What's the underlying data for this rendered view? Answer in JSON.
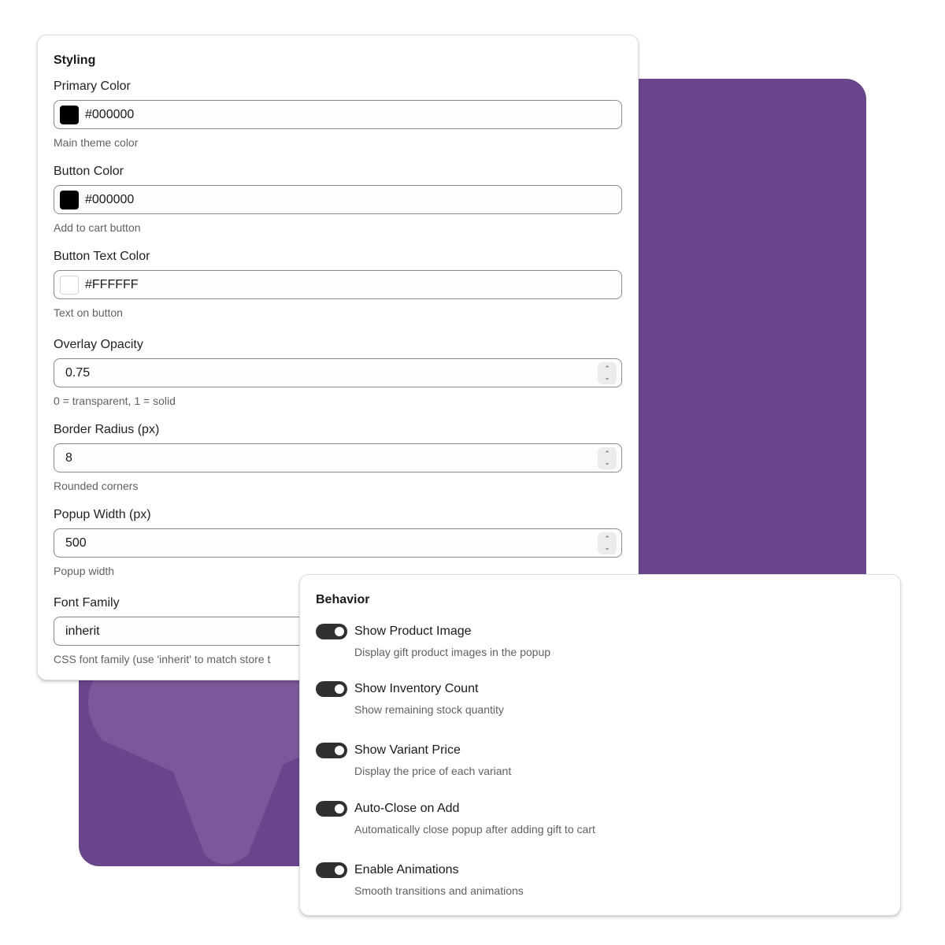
{
  "colors": {
    "background_card": "#6b458c",
    "toggle_on": "#303030"
  },
  "styling": {
    "title": "Styling",
    "primary_color": {
      "label": "Primary Color",
      "value": "#000000",
      "help": "Main theme color",
      "swatch": "#000000"
    },
    "button_color": {
      "label": "Button Color",
      "value": "#000000",
      "help": "Add to cart button",
      "swatch": "#000000"
    },
    "button_text_color": {
      "label": "Button Text Color",
      "value": "#FFFFFF",
      "help": "Text on button",
      "swatch": "#FFFFFF"
    },
    "overlay_opacity": {
      "label": "Overlay Opacity",
      "value": "0.75",
      "help": "0 = transparent, 1 = solid"
    },
    "border_radius": {
      "label": "Border Radius (px)",
      "value": "8",
      "help": "Rounded corners"
    },
    "popup_width": {
      "label": "Popup Width (px)",
      "value": "500",
      "help": "Popup width"
    },
    "font_family": {
      "label": "Font Family",
      "value": "inherit",
      "help": "CSS font family (use 'inherit' to match store t"
    }
  },
  "behavior": {
    "title": "Behavior",
    "toggles": [
      {
        "label": "Show Product Image",
        "help": "Display gift product images in the popup",
        "on": true
      },
      {
        "label": "Show Inventory Count",
        "help": "Show remaining stock quantity",
        "on": true
      },
      {
        "label": "Show Variant Price",
        "help": "Display the price of each variant",
        "on": true
      },
      {
        "label": "Auto-Close on Add",
        "help": "Automatically close popup after adding gift to cart",
        "on": true
      },
      {
        "label": "Enable Animations",
        "help": "Smooth transitions and animations",
        "on": true
      }
    ]
  }
}
